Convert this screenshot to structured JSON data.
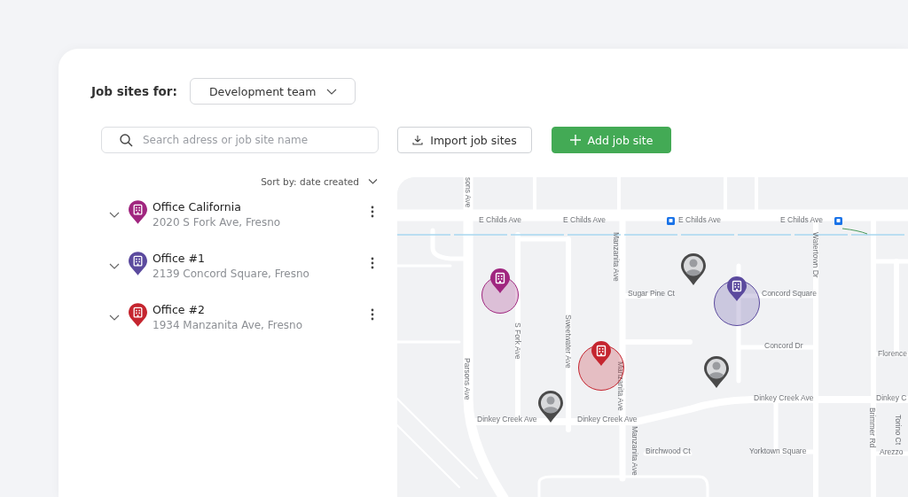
{
  "header": {
    "label": "Job sites for:",
    "team_dropdown": "Development team"
  },
  "search": {
    "placeholder": "Search adress or job site name"
  },
  "buttons": [
    {
      "label": "Import job sites",
      "kind": "import"
    },
    {
      "label": "Add job site",
      "kind": "add"
    }
  ],
  "sort": {
    "label": "Sort by: date created"
  },
  "job_sites": [
    {
      "name": "Office California",
      "address": "2020 S Fork Ave, Fresno",
      "color": "#a0267f"
    },
    {
      "name": "Office #1",
      "address": "2139 Concord Square, Fresno",
      "color": "#5b4a9e"
    },
    {
      "name": "Office #2",
      "address": "1934 Manzanita Ave, Fresno",
      "color": "#c5252f"
    }
  ],
  "map": {
    "street_labels": [
      "sons Ave",
      "E Childs Ave",
      "E Childs Ave",
      "E Childs Ave",
      "E Childs Ave",
      "Manzanita Ave",
      "Sugar Pine Ct",
      "Concord Square",
      "Watertown Dr",
      "S Fork Ave",
      "Sweetwater Ave",
      "Parsons Ave",
      "Manzanita Ave",
      "Concord Dr",
      "Florence",
      "Dinkey Creek Ave",
      "Dinkey C",
      "Dinkey Creek Ave",
      "Dinkey Creek Ave",
      "Manzanita Ave",
      "Birchwood Ct",
      "Yorktown Square",
      "Brimmer Rd",
      "Torino Ct",
      "Arezzo"
    ]
  }
}
